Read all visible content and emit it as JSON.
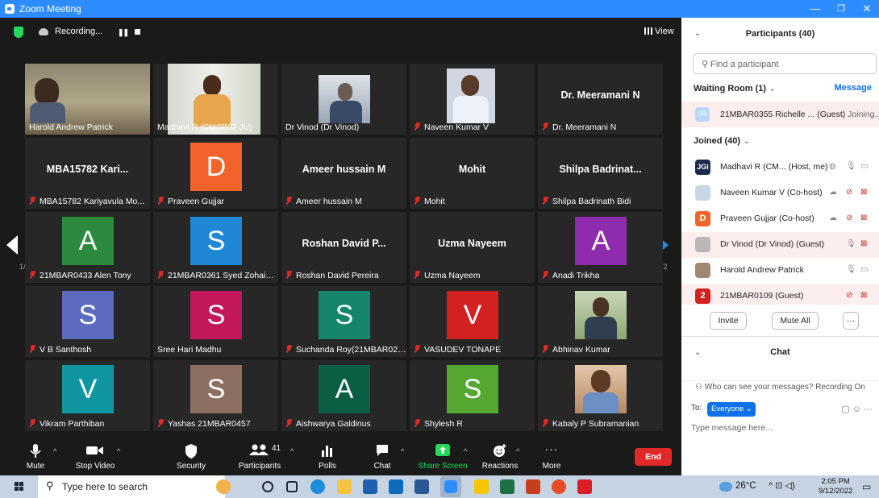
{
  "window": {
    "title": "Zoom Meeting",
    "minimize": "—",
    "restore": "❐",
    "close": "✕"
  },
  "topbar": {
    "recording_label": "Recording...",
    "view_label": "View",
    "pause_icon": "❚❚"
  },
  "pagination": {
    "left": "1/2",
    "right": "1/2"
  },
  "tiles": [
    {
      "name": "Harold Andrew Patrick",
      "muted": false,
      "kind": "photo",
      "active": true
    },
    {
      "name": "Madhavi R (CMSB02 JU)",
      "muted": false,
      "kind": "photo"
    },
    {
      "name": "Dr Vinod (Dr Vinod)",
      "muted": false,
      "kind": "photo"
    },
    {
      "name": "Naveen Kumar V",
      "muted": true,
      "kind": "photo"
    },
    {
      "name": "Dr. Meeramani N",
      "muted": true,
      "kind": "text",
      "big": "Dr. Meeramani N"
    },
    {
      "name": "MBA15782  Kariyavula Mo...",
      "muted": true,
      "kind": "text",
      "big": "MBA15782  Kari..."
    },
    {
      "name": "Praveen Gujjar",
      "muted": true,
      "kind": "avatar",
      "letter": "D",
      "color": "#f2642c"
    },
    {
      "name": "Ameer hussain M",
      "muted": true,
      "kind": "text",
      "big": "Ameer hussain M"
    },
    {
      "name": "Mohit",
      "muted": true,
      "kind": "text",
      "big": "Mohit"
    },
    {
      "name": "Shilpa Badrinath Bidi",
      "muted": true,
      "kind": "text",
      "big": "Shilpa  Badrinat..."
    },
    {
      "name": "21MBAR0433 Alen Tony",
      "muted": true,
      "kind": "avatar",
      "letter": "A",
      "color": "#2c8a3d"
    },
    {
      "name": "21MBAR0361 Syed Zohaib ...",
      "muted": true,
      "kind": "avatar",
      "letter": "S",
      "color": "#1e88d6"
    },
    {
      "name": "Roshan David Pereira",
      "muted": true,
      "kind": "text",
      "big": "Roshan David P..."
    },
    {
      "name": "Uzma Nayeem",
      "muted": true,
      "kind": "text",
      "big": "Uzma Nayeem"
    },
    {
      "name": "Anadi Trikha",
      "muted": true,
      "kind": "avatar",
      "letter": "A",
      "color": "#8e2cad"
    },
    {
      "name": "V B Santhosh",
      "muted": true,
      "kind": "avatar",
      "letter": "S",
      "color": "#5c6bc0"
    },
    {
      "name": "Sree Hari Madhu",
      "muted": false,
      "kind": "avatar",
      "letter": "S",
      "color": "#c2185b"
    },
    {
      "name": "Suchanda Roy(21MBAR0212)",
      "muted": true,
      "kind": "avatar",
      "letter": "S",
      "color": "#14856a"
    },
    {
      "name": "VASUDEV TONAPE",
      "muted": true,
      "kind": "avatar",
      "letter": "V",
      "color": "#d32020"
    },
    {
      "name": "Abhinav Kumar",
      "muted": true,
      "kind": "photo"
    },
    {
      "name": "Vikram Parthiban",
      "muted": true,
      "kind": "avatar",
      "letter": "V",
      "color": "#0f96a0"
    },
    {
      "name": "Yashas 21MBAR0457",
      "muted": true,
      "kind": "avatar",
      "letter": "S",
      "color": "#8d6e63"
    },
    {
      "name": "Aishwarya Galdinus",
      "muted": true,
      "kind": "avatar",
      "letter": "A",
      "color": "#0a5e44"
    },
    {
      "name": "Shylesh R",
      "muted": true,
      "kind": "avatar",
      "letter": "S",
      "color": "#56a632"
    },
    {
      "name": "Kabaly P Subramanian",
      "muted": true,
      "kind": "photo"
    }
  ],
  "toolbar": {
    "mute": "Mute",
    "stop_video": "Stop Video",
    "security": "Security",
    "participants": "Participants",
    "participants_count": "41",
    "polls": "Polls",
    "chat": "Chat",
    "share_screen": "Share Screen",
    "reactions": "Reactions",
    "more": "More",
    "end": "End"
  },
  "panel": {
    "title": "Participants (40)",
    "search_placeholder": "Find a participant",
    "waiting_room": "Waiting Room (1)",
    "message": "Message",
    "waiting": {
      "initials": "2R",
      "name": "21MBAR0355 Richelle ... (Guest)",
      "status": "Joining..."
    },
    "joined": "Joined (40)",
    "people": [
      {
        "name": "Madhavi R (CM...  (Host, me)",
        "avatar": "JGi",
        "color": "#1b2a4a"
      },
      {
        "name": "Naveen Kumar V (Co-host)",
        "avatar": "",
        "color": "#c9d6e4"
      },
      {
        "name": "Praveen Gujjar (Co-host)",
        "avatar": "D",
        "color": "#f2642c"
      },
      {
        "name": "Dr Vinod (Dr Vinod) (Guest)",
        "avatar": "",
        "color": "#b8b8b8"
      },
      {
        "name": "Harold Andrew Patrick",
        "avatar": "",
        "color": "#9e8a72"
      },
      {
        "name": "21MBAR0109 (Guest)",
        "avatar": "2",
        "color": "#d32020"
      }
    ],
    "invite": "Invite",
    "mute_all": "Mute All",
    "more": "···"
  },
  "chat": {
    "title": "Chat",
    "notice": "Who can see your messages? Recording On",
    "to_label": "To:",
    "to_value": "Everyone",
    "placeholder": "Type message here..."
  },
  "taskbar": {
    "search_placeholder": "Type here to search",
    "temperature": "26°C",
    "time": "2:05 PM",
    "date": "9/12/2022"
  }
}
